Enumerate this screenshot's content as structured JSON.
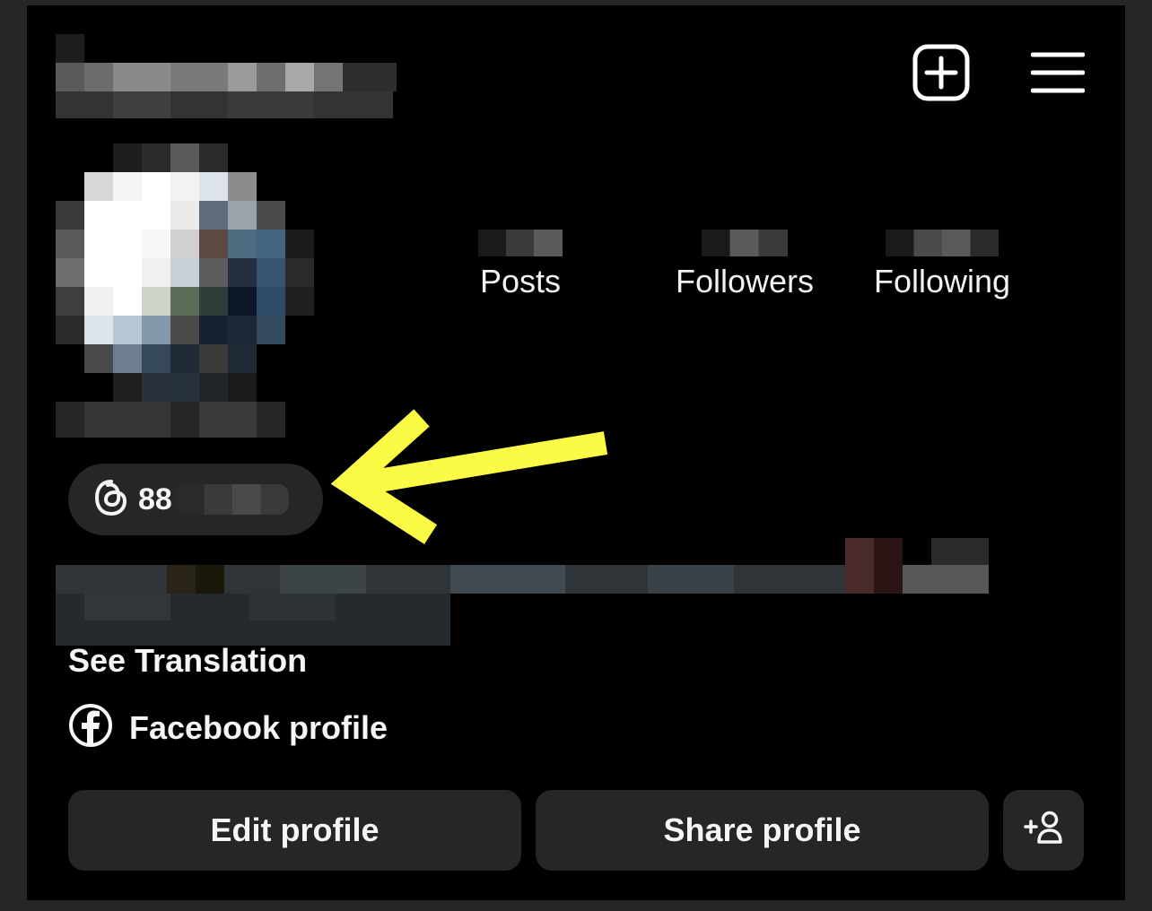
{
  "header": {
    "new_post_icon": "plus-square-icon",
    "menu_icon": "hamburger-menu-icon"
  },
  "stats": {
    "posts_label": "Posts",
    "followers_label": "Followers",
    "following_label": "Following"
  },
  "threads_badge": {
    "icon": "threads-icon",
    "text": "88"
  },
  "see_translation": "See Translation",
  "facebook_link": {
    "icon": "facebook-icon",
    "label": "Facebook profile"
  },
  "actions": {
    "edit_profile": "Edit profile",
    "share_profile": "Share profile",
    "add_person_icon": "add-person-icon"
  },
  "annotation": {
    "arrow_color": "#fbfb46"
  },
  "colors": {
    "background": "#000000",
    "button_bg": "#262626",
    "text": "#f5f5f5"
  }
}
